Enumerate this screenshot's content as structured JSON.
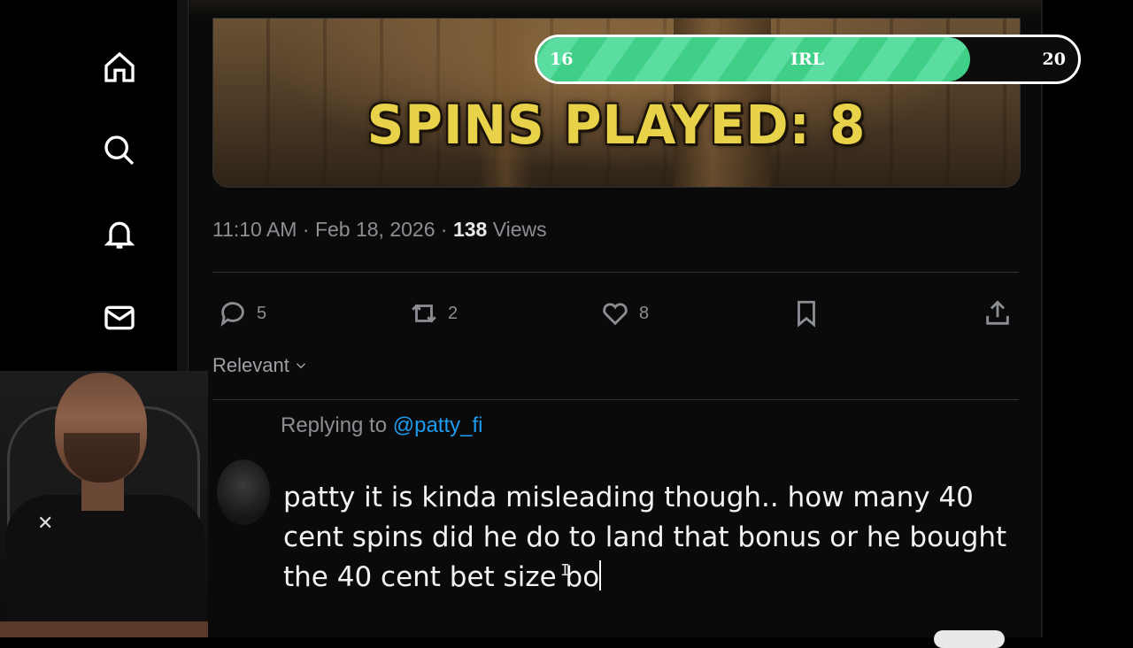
{
  "nav": {
    "items": [
      {
        "name": "home-icon"
      },
      {
        "name": "search-icon"
      },
      {
        "name": "bell-icon"
      },
      {
        "name": "mail-icon"
      }
    ]
  },
  "media": {
    "title": "SPINS PLAYED: 8"
  },
  "progress_overlay": {
    "start": "16",
    "label": "IRL",
    "end": "20",
    "fill_fraction": 0.8,
    "fill_color": "#3fcf86"
  },
  "post_meta": {
    "time": "11:10 AM",
    "separator": "·",
    "date": "Feb 18, 2026",
    "views_count": "138",
    "views_label": "Views"
  },
  "actions": {
    "replies": "5",
    "reposts": "2",
    "likes": "8"
  },
  "sort": {
    "label": "Relevant"
  },
  "reply": {
    "replying_to_label": "Replying to",
    "handle": "@patty_fi",
    "draft_text": "patty it is kinda misleading though.. how many 40 cent spins did he do to land that bonus or he bought the 40 cent bet size bo"
  },
  "colors": {
    "background": "#000000",
    "link": "#1d9bf0",
    "muted_text": "#8b8f94"
  }
}
